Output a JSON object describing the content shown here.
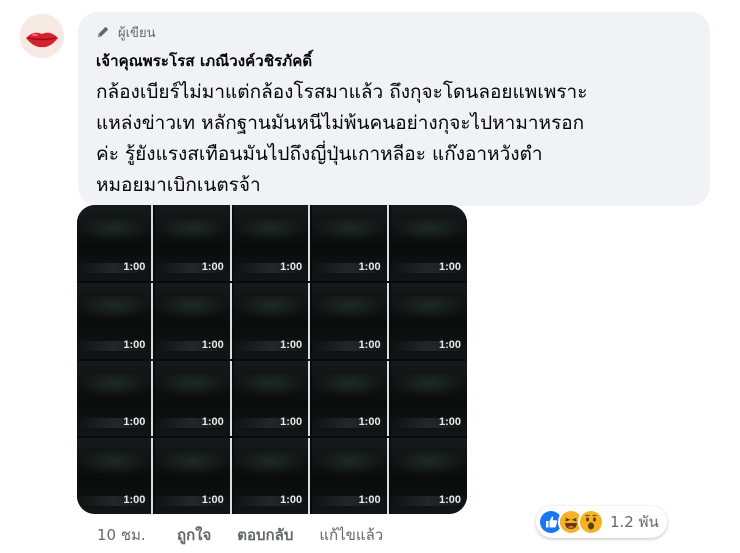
{
  "comment": {
    "author_badge": "ผู้เขียน",
    "author_name": "เจ้าคุณพระโรส เภณีวงค์วชิรภัคดิ์",
    "text_lines": [
      "กล้องเบียร์ไม่มาแต่กล้องโรสมาแล้ว ถึงกุจะโดนลอยแพเพราะ",
      "แหล่งข่าวเท หลักฐานมันหนีไม่พ้นคนอย่างกุจะไปหามาหรอก",
      "ค่ะ รู้ยังแรงสเทือนมันไปถึงญี่ปุ่นเกาหลีอะ แก๊งอาหวังตำ",
      "หมอยมาเบิกเนตรจ้า"
    ]
  },
  "media": {
    "frame_time": "1:00",
    "frames": 20
  },
  "meta": {
    "time": "10 ชม.",
    "like": "ถูกใจ",
    "reply": "ตอบกลับ",
    "edited": "แก้ไขแล้ว"
  },
  "reactions": {
    "icons": [
      "like-icon",
      "haha-icon",
      "wow-icon"
    ],
    "count": "1.2 พัน",
    "colors": {
      "like": "#1877f2",
      "emoji": "#f7b125"
    }
  }
}
